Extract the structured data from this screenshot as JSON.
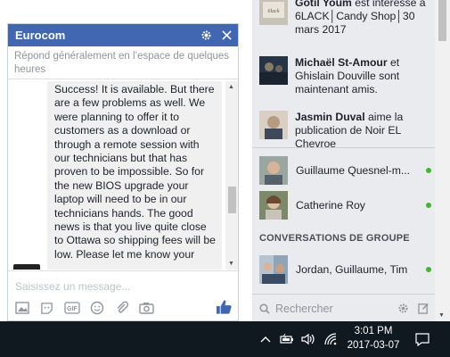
{
  "chat": {
    "title": "Eurocom",
    "subtitle": "Répond généralement en l’espace de quelques heures",
    "message": "Success! It is available. But there are a few problems as well. We were planning to offer it to customers as a download or through a remote session with our technicians but that has proven to be impossible. So for the new BIOS upgrade your laptop will need to be in our technicians hands. The good news is that you live quite close to Ottawa so shipping fees will be low. Please let me know your",
    "input_placeholder": "Saisissez un message...",
    "icons": [
      "gear-icon",
      "close-icon",
      "photo-icon",
      "sticker-icon",
      "gif-icon",
      "emoji-icon",
      "attachment-icon",
      "camera-icon",
      "like-icon"
    ]
  },
  "ticker": [
    {
      "name": "Gotil Youm",
      "text": " est intéressé à 6LACK│Candy Shop│30 mars 2017"
    },
    {
      "name": "Michaël St-Amour",
      "text": " et Ghislain Douville sont maintenant amis."
    },
    {
      "name": "Jasmin Duval",
      "text": " aime la publication de Noir EL Chevroe"
    }
  ],
  "contacts": [
    {
      "name": "Guillaume Quesnel-m...",
      "online": true
    },
    {
      "name": "Catherine Roy",
      "online": true
    }
  ],
  "group_section_title": "CONVERSATIONS DE GROUPE",
  "groups": [
    {
      "name": "Jordan, Guillaume, Tim",
      "online": true
    }
  ],
  "search_placeholder": "Rechercher",
  "taskbar": {
    "time": "3:01 PM",
    "date": "2017-03-07"
  },
  "colors": {
    "accent": "#4267b2",
    "online": "#42b72a",
    "sidebar_bg": "#e9ebee",
    "taskbar_bg": "#101820"
  }
}
